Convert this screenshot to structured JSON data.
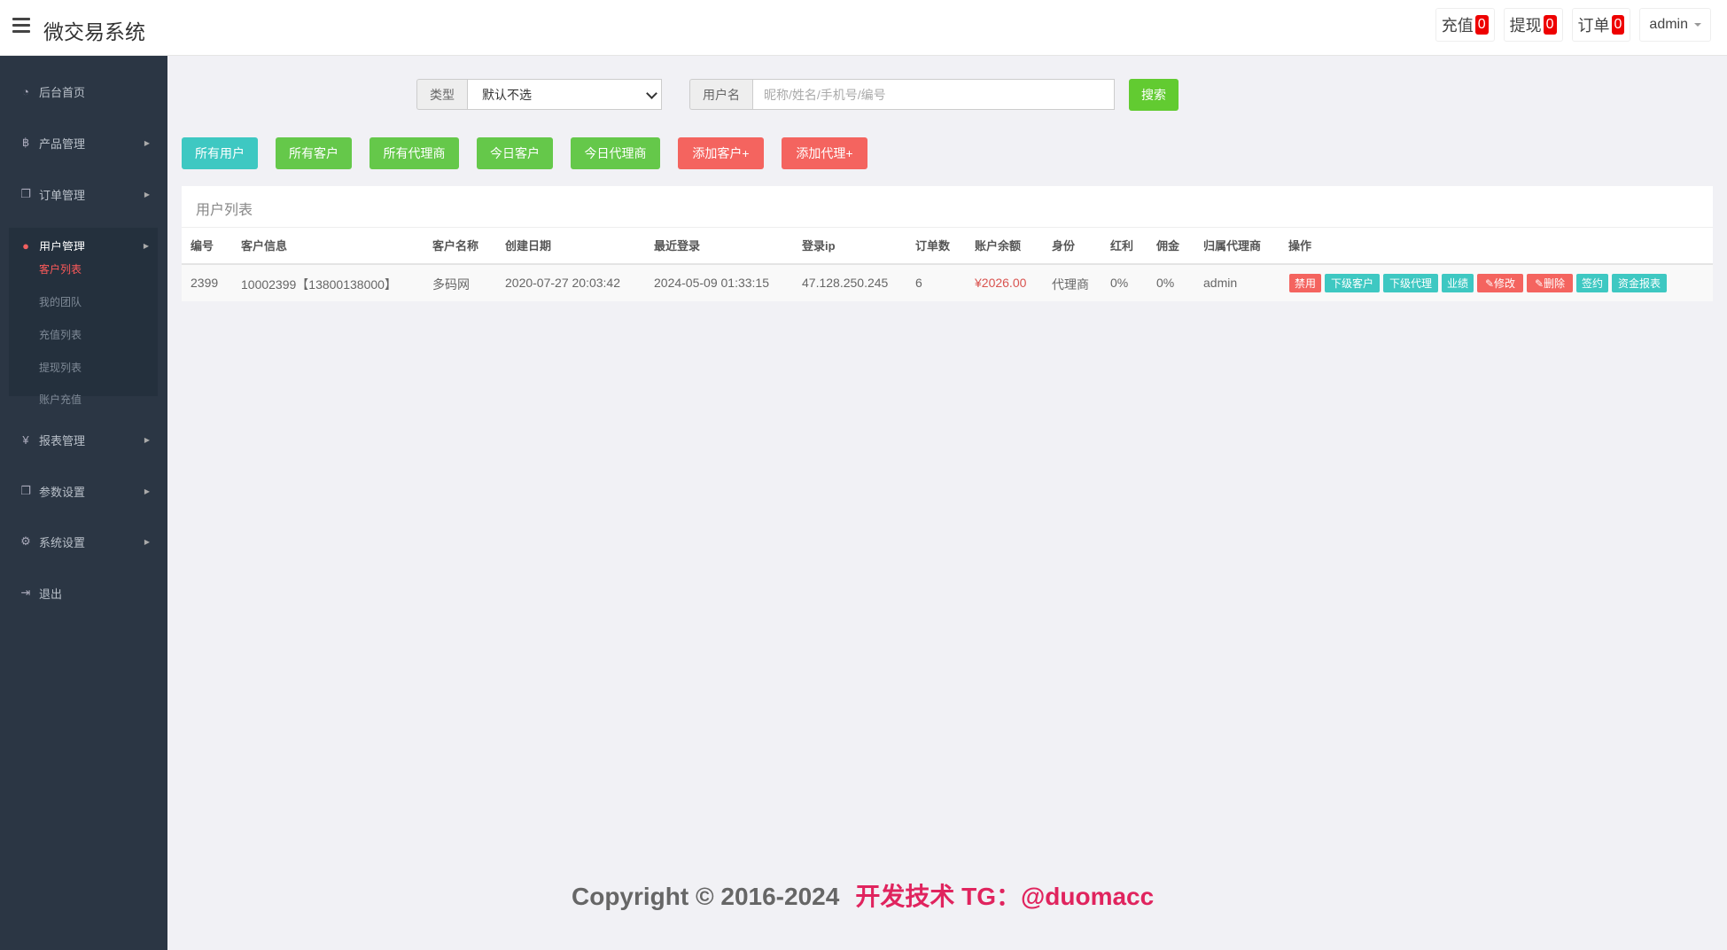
{
  "header": {
    "title": "微交易系统",
    "recharge_label": "充值",
    "recharge_count": "0",
    "withdraw_label": "提现",
    "withdraw_count": "0",
    "order_label": "订单",
    "order_count": "0",
    "user": "admin"
  },
  "sidebar": {
    "items": [
      {
        "label": "后台首页",
        "icon": "dashboard-icon"
      },
      {
        "label": "产品管理",
        "icon": "bitcoin-icon"
      },
      {
        "label": "订单管理",
        "icon": "copy-icon"
      },
      {
        "label": "用户管理",
        "icon": "user-icon"
      },
      {
        "label": "报表管理",
        "icon": "yen-icon"
      },
      {
        "label": "参数设置",
        "icon": "copy-icon"
      },
      {
        "label": "系统设置",
        "icon": "gears-icon"
      },
      {
        "label": "退出",
        "icon": "sign-out-icon"
      }
    ],
    "submenu": [
      "客户列表",
      "我的团队",
      "充值列表",
      "提现列表",
      "账户充值"
    ]
  },
  "search": {
    "type_label": "类型",
    "type_value": "默认不选",
    "user_label": "用户名",
    "user_placeholder": "昵称/姓名/手机号/编号",
    "button": "搜索"
  },
  "filters": [
    "所有用户",
    "所有客户",
    "所有代理商",
    "今日客户",
    "今日代理商",
    "添加客户+",
    "添加代理+"
  ],
  "table": {
    "title": "用户列表",
    "columns": [
      "编号",
      "客户信息",
      "客户名称",
      "创建日期",
      "最近登录",
      "登录ip",
      "订单数",
      "账户余额",
      "身份",
      "红利",
      "佣金",
      "归属代理商",
      "操作"
    ],
    "rows": [
      {
        "id": "2399",
        "info": "10002399【13800138000】",
        "name": "多码网",
        "created": "2020-07-27 20:03:42",
        "last_login": "2024-05-09 01:33:15",
        "ip": "47.128.250.245",
        "orders": "6",
        "balance": "¥2026.00",
        "role": "代理商",
        "bonus": "0%",
        "commission": "0%",
        "agent": "admin",
        "actions": [
          "禁用",
          "下级客户",
          "下级代理",
          "业绩",
          "修改",
          "删除",
          "签约",
          "资金报表"
        ]
      }
    ]
  },
  "footer": {
    "copyright": "Copyright © 2016-2024",
    "dev": "开发技术 TG：@duomacc"
  }
}
